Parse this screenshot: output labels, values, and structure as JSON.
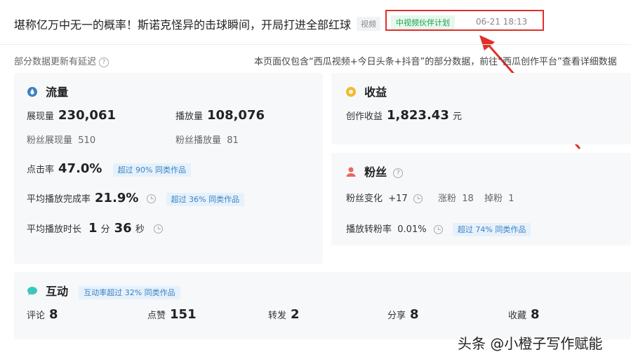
{
  "header": {
    "title": "堪称亿万中无一的概率！斯诺克怪异的击球瞬间，开局打进全部红球",
    "type_tag": "视频",
    "partner_tag": "中视频伙伴计划",
    "datetime": "06-21 18:13"
  },
  "notes": {
    "delay": "部分数据更新有延迟",
    "help_mark": "?",
    "scope": "本页面仅包含“西瓜视频+今日头条+抖音”的部分数据，前往“西瓜创作平台”查看详细数据"
  },
  "flow": {
    "title": "流量",
    "impressions_label": "展现量",
    "impressions": "230,061",
    "plays_label": "播放量",
    "plays": "108,076",
    "fan_impressions_label": "粉丝展现量",
    "fan_impressions": "510",
    "fan_plays_label": "粉丝播放量",
    "fan_plays": "81",
    "ctr_label": "点击率",
    "ctr": "47.0%",
    "ctr_badge": "超过 90% 同类作品",
    "completion_label": "平均播放完成率",
    "completion": "21.9%",
    "completion_badge": "超过 36% 同类作品",
    "duration_label": "平均播放时长",
    "duration_min": "1",
    "min_unit": "分",
    "duration_sec": "36",
    "sec_unit": "秒"
  },
  "income": {
    "title": "收益",
    "creation_label": "创作收益",
    "creation_value": "1,823.43",
    "unit": "元"
  },
  "fans": {
    "title": "粉丝",
    "change_label": "粉丝变化",
    "change_value": "+17",
    "gain_label": "涨粉",
    "gain_value": "18",
    "loss_label": "掉粉",
    "loss_value": "1",
    "conv_label": "播放转粉率",
    "conv_value": "0.01%",
    "conv_badge": "超过 74% 同类作品"
  },
  "interaction": {
    "title": "互动",
    "badge": "互动率超过 32% 同类作品",
    "comments_label": "评论",
    "comments": "8",
    "likes_label": "点赞",
    "likes": "151",
    "shares_label": "转发",
    "shares": "2",
    "share_out_label": "分享",
    "share_out": "8",
    "favorites_label": "收藏",
    "favorites": "8"
  },
  "watermark": "头条 @小橙子写作赋能",
  "colors": {
    "annotation_red": "#e0302a",
    "partner_green": "#16a34a",
    "badge_blue": "#3b82c4"
  }
}
